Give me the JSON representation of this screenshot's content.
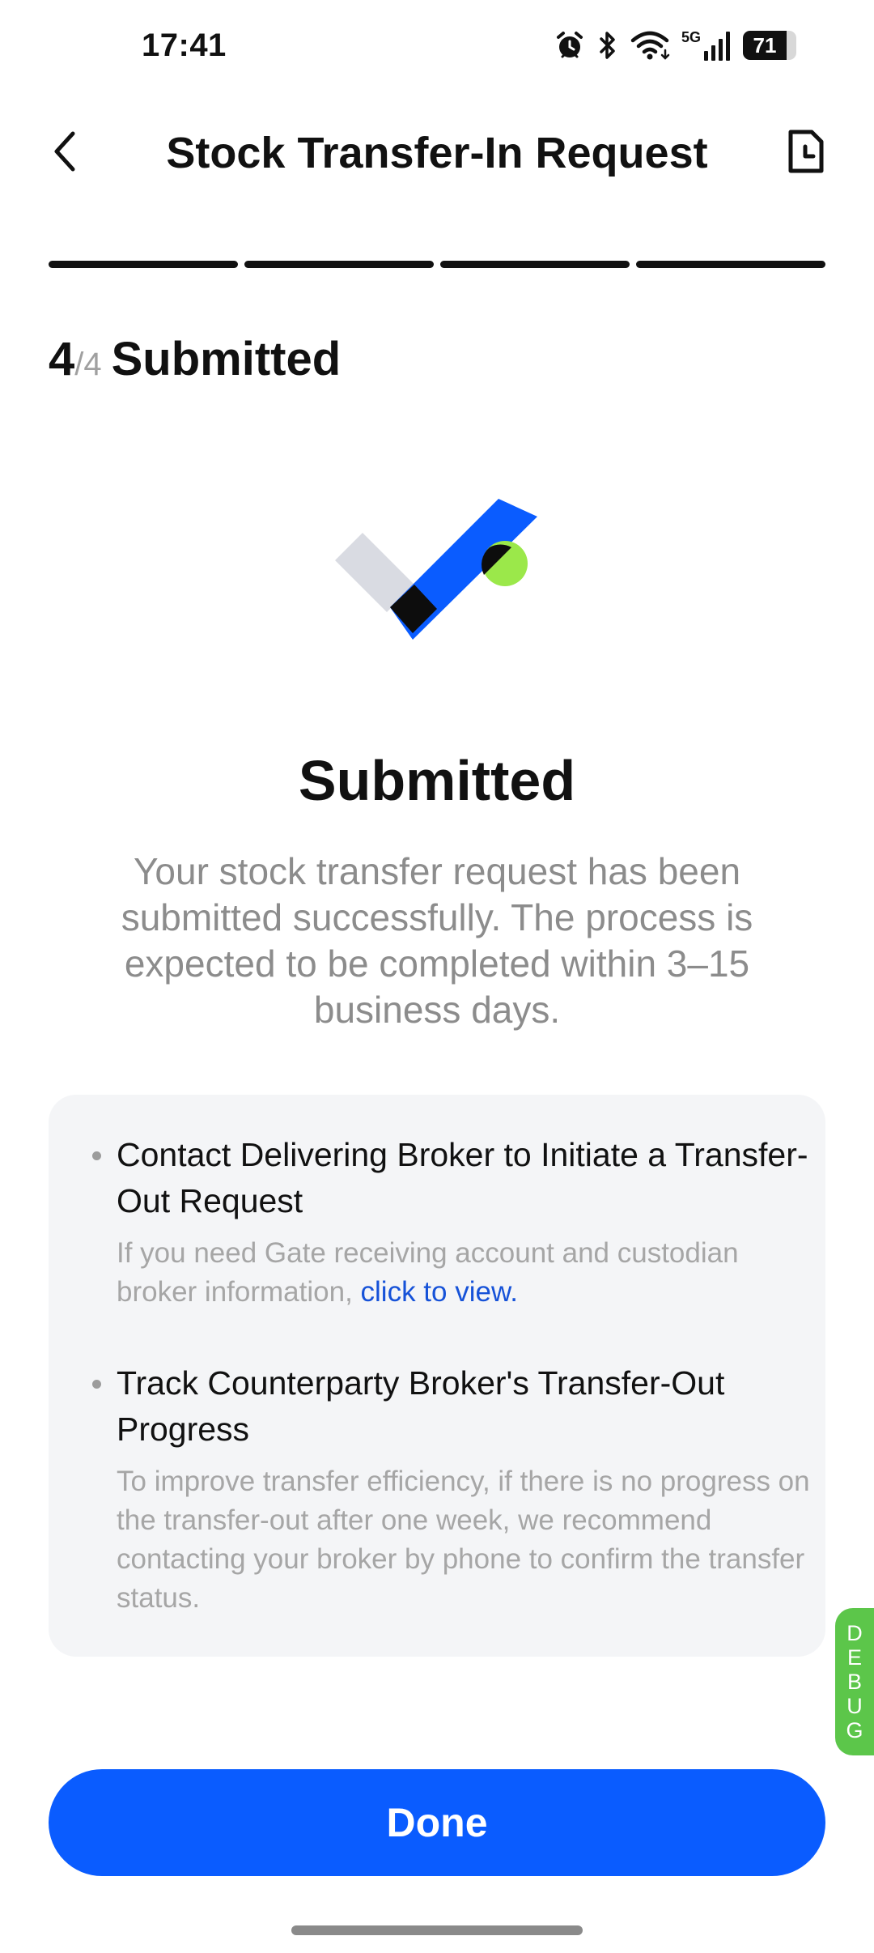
{
  "status_bar": {
    "time": "17:41",
    "network": "5G",
    "battery": "71",
    "battery_level": 0.71,
    "icons": [
      "alarm-icon",
      "bluetooth-icon",
      "wifi-icon",
      "cellular-signal-icon",
      "battery-icon"
    ]
  },
  "header": {
    "title": "Stock Transfer-In Request",
    "back_icon": "chevron-left-icon",
    "history_icon": "document-history-icon"
  },
  "progress": {
    "current_step": "4",
    "total_steps": "/4",
    "step_name": "Submitted",
    "segments_complete": 4,
    "segment_count": 4
  },
  "result": {
    "title": "Submitted",
    "description": "Your stock transfer request has been submitted successfully. The process is expected to be completed within 3–15 business days."
  },
  "info": {
    "items": [
      {
        "title": "Contact Delivering Broker to Initiate a Transfer-Out Request",
        "description": "If you need Gate receiving account and custodian broker information,",
        "link": "click to view."
      },
      {
        "title": "Track Counterparty Broker's Transfer-Out Progress",
        "description": "To improve transfer efficiency, if there is no progress on the transfer-out after one week, we recommend contacting your broker by phone to confirm the transfer status."
      }
    ]
  },
  "debug": {
    "label": "DEBUG",
    "letters": [
      "D",
      "E",
      "B",
      "U",
      "G"
    ]
  },
  "footer": {
    "done_label": "Done"
  },
  "colors": {
    "primary": "#0a5cff",
    "link": "#1652d8",
    "progress_done": "#111111",
    "progress_todo": "#e0e0e0",
    "card_bg": "#f4f5f7",
    "accent_green": "#9be84a",
    "debug_green": "#5cc64a"
  }
}
